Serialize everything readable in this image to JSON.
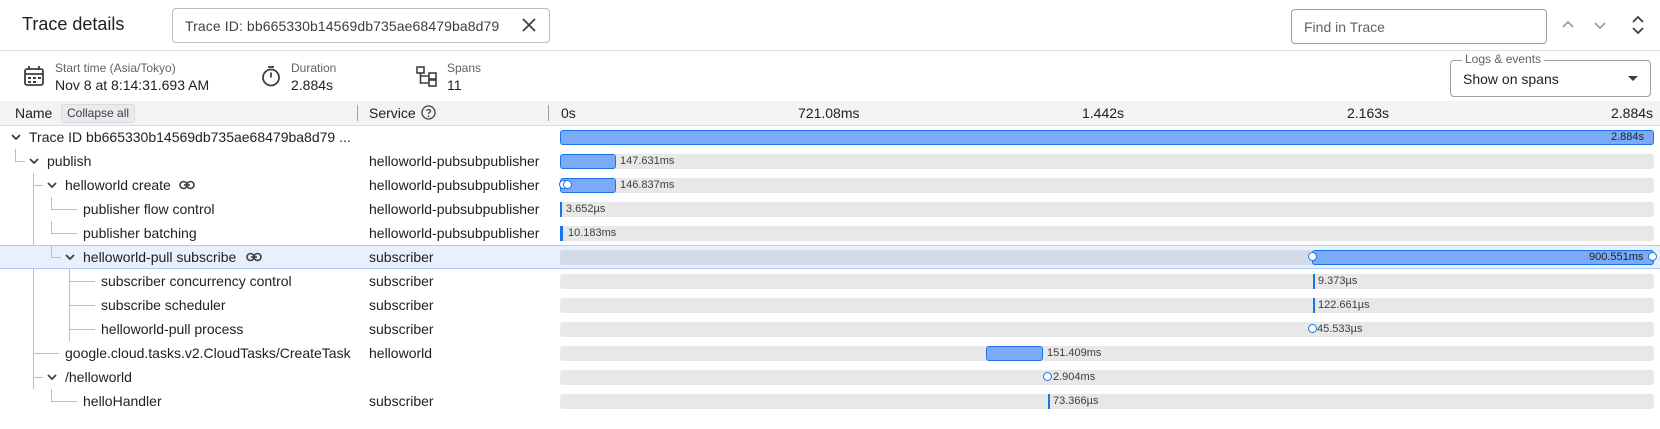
{
  "header": {
    "title": "Trace details",
    "trace_filter": "Trace ID: bb665330b14569db735ae68479ba8d79",
    "find_placeholder": "Find in Trace"
  },
  "info": {
    "start_label": "Start time (Asia/Tokyo)",
    "start_value": "Nov 8 at 8:14:31.693 AM",
    "duration_label": "Duration",
    "duration_value": "2.884s",
    "spans_label": "Spans",
    "spans_value": "11",
    "logs_label": "Logs & events",
    "logs_value": "Show on spans"
  },
  "columns": {
    "name": "Name",
    "collapse_all": "Collapse all",
    "service": "Service",
    "ticks": [
      "0s",
      "721.08ms",
      "1.442s",
      "2.163s",
      "2.884s"
    ]
  },
  "rows": [
    {
      "name": "Trace ID bb665330b14569db735ae68479ba8d79 ...",
      "service": "",
      "duration": "2.884s"
    },
    {
      "name": "publish",
      "service": "helloworld-pubsubpublisher",
      "duration": "147.631ms"
    },
    {
      "name": "helloworld create",
      "service": "helloworld-pubsubpublisher",
      "duration": "146.837ms"
    },
    {
      "name": "publisher flow control",
      "service": "helloworld-pubsubpublisher",
      "duration": "3.652µs"
    },
    {
      "name": "publisher batching",
      "service": "helloworld-pubsubpublisher",
      "duration": "10.183ms"
    },
    {
      "name": "helloworld-pull subscribe",
      "service": "subscriber",
      "duration": "900.551ms"
    },
    {
      "name": "subscriber concurrency control",
      "service": "subscriber",
      "duration": "9.373µs"
    },
    {
      "name": "subscribe scheduler",
      "service": "subscriber",
      "duration": "122.661µs"
    },
    {
      "name": "helloworld-pull process",
      "service": "subscriber",
      "duration": "45.533µs"
    },
    {
      "name": "google.cloud.tasks.v2.CloudTasks/CreateTask",
      "service": "helloworld",
      "duration": "151.409ms"
    },
    {
      "name": "/helloworld",
      "service": "",
      "duration": "2.904ms"
    },
    {
      "name": "helloHandler",
      "service": "subscriber",
      "duration": "73.366µs"
    }
  ],
  "colors": {
    "accent": "#1a73e8",
    "bar_fill": "#7baaf7",
    "selected_row": "#e8f0fe"
  }
}
